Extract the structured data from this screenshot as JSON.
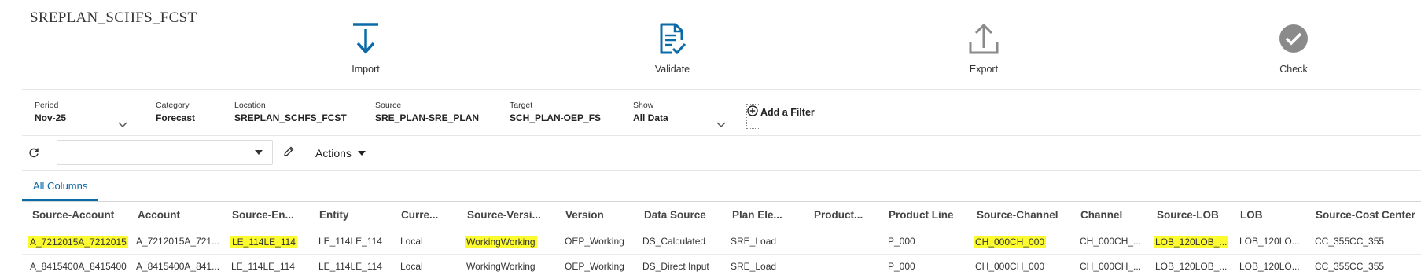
{
  "app_title": "SREPLAN_SCHFS_FCST",
  "steps": {
    "import": "Import",
    "validate": "Validate",
    "export": "Export",
    "check": "Check"
  },
  "filters": {
    "period": {
      "label": "Period",
      "value": "Nov-25"
    },
    "category": {
      "label": "Category",
      "value": "Forecast"
    },
    "location": {
      "label": "Location",
      "value": "SREPLAN_SCHFS_FCST"
    },
    "source": {
      "label": "Source",
      "value": "SRE_PLAN-SRE_PLAN"
    },
    "target": {
      "label": "Target",
      "value": "SCH_PLAN-OEP_FS"
    },
    "show": {
      "label": "Show",
      "value": "All Data"
    },
    "add_filter": "Add a Filter"
  },
  "toolbar": {
    "actions_label": "Actions"
  },
  "tabs": [
    "All Columns"
  ],
  "columns": [
    "Source-Account",
    "Account",
    "Source-En...",
    "Entity",
    "Curre...",
    "Source-Versi...",
    "Version",
    "Data Source",
    "Plan Ele...",
    "Product...",
    "Product Line",
    "Source-Channel",
    "Channel",
    "Source-LOB",
    "LOB",
    "Source-Cost Center"
  ],
  "rows": [
    [
      "A_7212015A_7212015",
      "A_7212015A_721...",
      "LE_114LE_114",
      "LE_114LE_114",
      "Local",
      "WorkingWorking",
      "OEP_Working",
      "DS_Calculated",
      "SRE_Load",
      "",
      "P_000",
      "CH_000CH_000",
      "CH_000CH_...",
      "LOB_120LOB_...",
      "LOB_120LO...",
      "CC_355CC_355"
    ],
    [
      "A_8415400A_8415400",
      "A_8415400A_841...",
      "LE_114LE_114",
      "LE_114LE_114",
      "Local",
      "WorkingWorking",
      "OEP_Working",
      "DS_Direct Input",
      "SRE_Load",
      "",
      "P_000",
      "CH_000CH_000",
      "CH_000CH_...",
      "LOB_120LOB_...",
      "LOB_120LO...",
      "CC_355CC_355"
    ]
  ],
  "colors": {
    "accent": "#0b6aa8",
    "highlight": "#fbfb2f",
    "check_icon": "#8a8a8a",
    "export_icon": "#8a8a8a"
  }
}
